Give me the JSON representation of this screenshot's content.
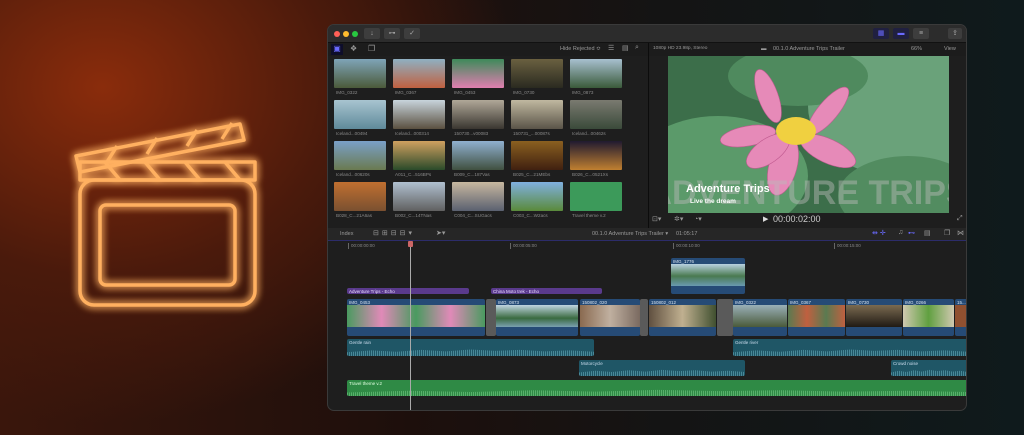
{
  "window": {
    "hide_rejected": "Hide Rejected ≎",
    "format": "1080p HD 23.98p, Stereo",
    "project": "00.1.0 Adventure Trips Trailer",
    "zoom": "66%",
    "view": "View",
    "timecode": "00:00:02:00",
    "index": "Index",
    "timeline_project": "00.1.0 Adventure Trips Trailer ▾",
    "duration": "01:05:17"
  },
  "viewer": {
    "title": "Adventure Trips",
    "subtitle": "Live the dream",
    "bg_title": "ADVENTURE TRIPS"
  },
  "colors": {
    "accent": "#ff7a1a",
    "title_clip": "#5a3a8c",
    "video_clip": "#264b76",
    "audio_clip": "#1f5666",
    "music_clip": "#2f8a45"
  },
  "browser": {
    "items": [
      {
        "label": "IMG_0322",
        "c1": "#7fa4b8",
        "c2": "#4b5a3a"
      },
      {
        "label": "IMG_0367",
        "c1": "#8fb0c2",
        "c2": "#c06040"
      },
      {
        "label": "IMG_0453",
        "c1": "#3d8a5a",
        "c2": "#e07fb0"
      },
      {
        "label": "IMG_0730",
        "c1": "#6a6040",
        "c2": "#2a2a20"
      },
      {
        "label": "IMG_0873",
        "c1": "#a8c0d0",
        "c2": "#3a5a3a"
      },
      {
        "label": "Iceland...00494",
        "c1": "#a8c4d0",
        "c2": "#5f8a9a"
      },
      {
        "label": "Iceland...000314",
        "c1": "#c8d4dc",
        "c2": "#5a5040"
      },
      {
        "label": "150730...v00083",
        "c1": "#b0a898",
        "c2": "#3a3630"
      },
      {
        "label": "150731_...00087s",
        "c1": "#c0b8a0",
        "c2": "#5a5448"
      },
      {
        "label": "Iceland...00462s",
        "c1": "#7a7a70",
        "c2": "#3a4a3a"
      },
      {
        "label": "Iceland...00620s",
        "c1": "#7aa0c8",
        "c2": "#6a7a50"
      },
      {
        "label": "A011_C...516BPs",
        "c1": "#d0a060",
        "c2": "#2a4a2a"
      },
      {
        "label": "B009_C...187Vas",
        "c1": "#90b0d0",
        "c2": "#405040"
      },
      {
        "label": "B025_C...21MEbs",
        "c1": "#8a6020",
        "c2": "#402010"
      },
      {
        "label": "B026_C...0521Xs",
        "c1": "#201a30",
        "c2": "#c08030"
      },
      {
        "label": "B028_C...21A6as",
        "c1": "#c07030",
        "c2": "#7a5030"
      },
      {
        "label": "B002_C...14TNas",
        "c1": "#b0c0d0",
        "c2": "#606060"
      },
      {
        "label": "C004_C...SUGacs",
        "c1": "#c8b8a0",
        "c2": "#5a6070"
      },
      {
        "label": "C003_C...W2acs",
        "c1": "#80b0e0",
        "c2": "#5a8a3a"
      },
      {
        "label": "Travel theme v.2",
        "c1": "#3c9a5a",
        "c2": "#3c9a5a"
      }
    ]
  },
  "ruler": [
    "00:00:00:00",
    "00:00:05:00",
    "00:00:10:00",
    "00:00:15:00"
  ],
  "timeline": {
    "connected": [
      {
        "label": "IMG_1776"
      }
    ],
    "titles": [
      {
        "label": "Adventure Trips - Echo"
      },
      {
        "label": "China Moto trek - Echo"
      }
    ],
    "primary": [
      {
        "label": "IMG_0453"
      },
      {
        "label": "IMG_0873"
      },
      {
        "label": "150802_020"
      },
      {
        "label": "150802_012"
      },
      {
        "label": "IMG_0322"
      },
      {
        "label": "IMG_0367"
      },
      {
        "label": "IMG_0730"
      },
      {
        "label": "IMG_0266"
      },
      {
        "label": "15..."
      }
    ],
    "audio": [
      {
        "label": "Gentle rain"
      },
      {
        "label": "Gentle river"
      },
      {
        "label": "Motorcycle"
      },
      {
        "label": "Crowd noise"
      }
    ],
    "music": {
      "label": "Travel theme v.2"
    }
  }
}
